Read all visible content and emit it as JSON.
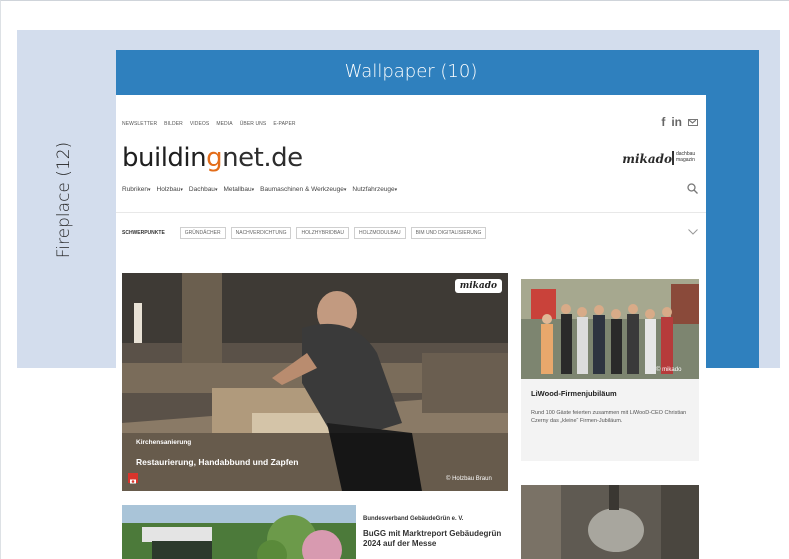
{
  "fireplace": {
    "label": "Fireplace (12)",
    "color": "#d3dded"
  },
  "wallpaper": {
    "label": "Wallpaper (10)",
    "color": "#2f80be"
  },
  "site": {
    "topnav": [
      "NEWSLETTER",
      "BILDER",
      "VIDEOS",
      "MEDIA",
      "ÜBER UNS",
      "E-PAPER"
    ],
    "social": {
      "facebook": "f",
      "linkedin": "in",
      "mail_icon": "mail-icon"
    },
    "logo": {
      "part1": "buildin",
      "part2": "g",
      "part3": "net.de"
    },
    "partner_logos": {
      "mikado": "mikado",
      "dachbau_line1": "dachbau",
      "dachbau_line2": "magazin"
    },
    "mainnav": [
      "Rubriken",
      "Holzbau",
      "Dachbau",
      "Metallbau",
      "Baumaschinen & Werkzeuge",
      "Nutzfahrzeuge"
    ],
    "caret": "▾",
    "topics_label": "SCHWERPUNKTE",
    "topics": [
      "GRÜNDÄCHER",
      "NACHVERDICHTUNG",
      "HOLZHYBRIDBAU",
      "HOLZMODULBAU",
      "BIM UND DIGITALISIERUNG"
    ],
    "hero": {
      "badge": "mikado",
      "kicker": "Kirchensanierung",
      "title": "Restaurierung, Handabbund und Zapfen",
      "credit": "© Holzbau Braun"
    },
    "side_card": {
      "credit": "© mikado",
      "title": "LiWood-Firmenjubiläum",
      "text": "Rund 100 Gäste feierten zusammen mit LiWooD-CEO Christian Czerny das „kleine“ Firmen-Jubiläum."
    },
    "card2": {
      "kicker": "Bundesverband GebäudeGrün e. V.",
      "title": "BuGG mit Marktreport Gebäudegrün 2024 auf der Messe"
    }
  }
}
